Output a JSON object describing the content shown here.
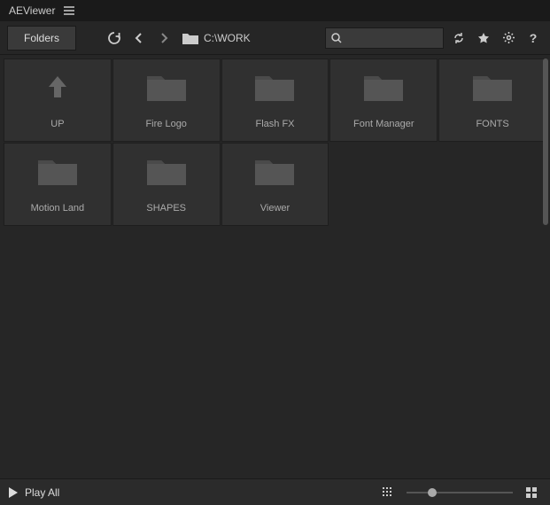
{
  "app": {
    "title": "AEViewer"
  },
  "toolbar": {
    "folders_label": "Folders",
    "path": "C:\\WORK"
  },
  "search": {
    "placeholder": ""
  },
  "items": [
    {
      "type": "up",
      "label": "UP"
    },
    {
      "type": "folder",
      "label": "Fire Logo"
    },
    {
      "type": "folder",
      "label": "Flash FX"
    },
    {
      "type": "folder",
      "label": "Font Manager"
    },
    {
      "type": "folder",
      "label": "FONTS"
    },
    {
      "type": "folder",
      "label": "Motion Land"
    },
    {
      "type": "folder",
      "label": "SHAPES"
    },
    {
      "type": "folder",
      "label": "Viewer"
    }
  ],
  "footer": {
    "play_all_label": "Play All"
  },
  "colors": {
    "bg": "#262626",
    "tile": "#303030",
    "folder": "#555555"
  }
}
